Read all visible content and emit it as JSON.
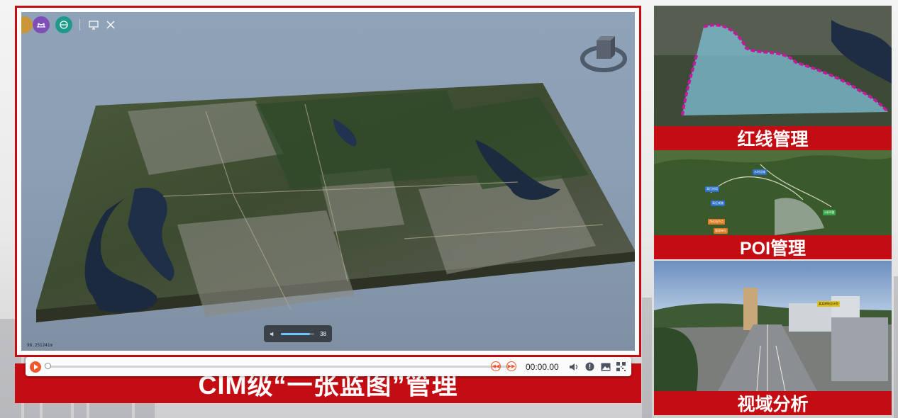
{
  "viewer": {
    "scale_text": "98.251241m",
    "toolbar": {
      "icons": [
        "terrain-icon",
        "bridge-icon",
        "globe-layer-icon",
        "screen-icon",
        "tools-icon"
      ],
      "colors": [
        "#c9973a",
        "#7e4fb6",
        "#1d9a8c"
      ]
    },
    "volume": {
      "value": "38",
      "fraction": 0.88
    }
  },
  "player": {
    "time": "00:00.00",
    "progress": 0.0,
    "accent": "#ee5a2b"
  },
  "main_caption": "CIM级“一张蓝图”管理",
  "cards": [
    {
      "label": "红线管理"
    },
    {
      "label": "POI管理"
    },
    {
      "label": "视域分析"
    }
  ],
  "poi_tags": [
    "高压线塔",
    "高压线路",
    "水利设施",
    "净化站节点",
    "管理单位",
    "3米环路"
  ],
  "billboard_text": "某某建筑设计院",
  "colors": {
    "brand_red": "#c40d12"
  }
}
